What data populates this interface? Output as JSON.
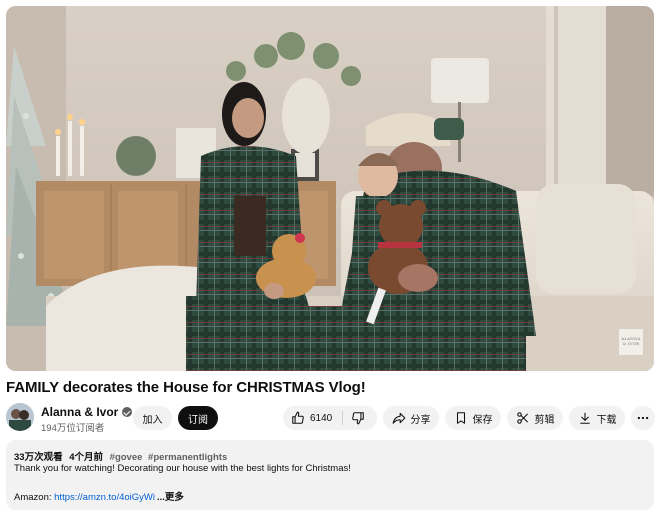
{
  "video": {
    "watermark": "ALANNA & IVOR"
  },
  "title": "FAMILY decorates the House for CHRISTMAS Vlog!",
  "channel": {
    "name": "Alanna & Ivor",
    "subscribers": "194万位订阅者",
    "join_label": "加入",
    "subscribe_label": "订阅"
  },
  "actions": {
    "likes": "6140",
    "share_label": "分享",
    "save_label": "保存",
    "clip_label": "剪辑",
    "download_label": "下载"
  },
  "description": {
    "views": "33万次观看",
    "date": "4个月前",
    "tags": [
      "#govee",
      "#permanentlights"
    ],
    "line1": "Thank you for watching! Decorating our house with the best lights for Christmas!",
    "amazon_label": "Amazon: ",
    "amazon_link": "https://amzn.to/4oiGyWi",
    "more_label": "...更多"
  },
  "colors": {
    "subscribe_bg": "#0f0f0f",
    "pill_bg": "#f2f2f2",
    "link": "#065fd4",
    "secondary_text": "#606060"
  },
  "icons": [
    "thumbs-up-icon",
    "thumbs-down-icon",
    "share-icon",
    "save-icon",
    "scissors-icon",
    "download-icon",
    "more-icon",
    "verified-icon"
  ]
}
